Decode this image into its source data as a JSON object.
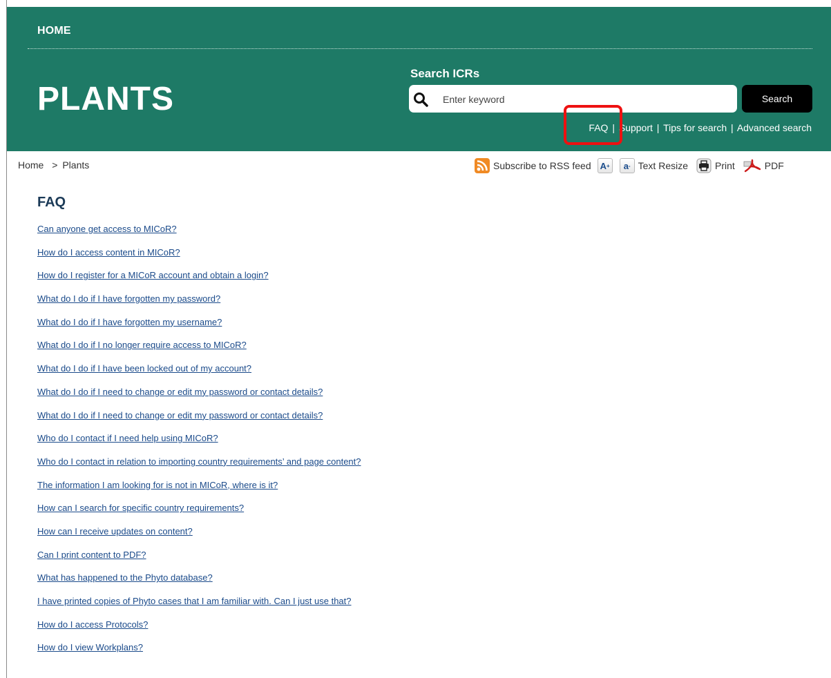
{
  "nav": {
    "home_label": "HOME"
  },
  "header": {
    "site_title": "PLANTS",
    "search_label": "Search ICRs",
    "search_placeholder": "Enter keyword",
    "search_button": "Search",
    "help_links": [
      "FAQ",
      "Support",
      "Tips for search",
      "Advanced search"
    ],
    "help_separator": "|"
  },
  "breadcrumb": {
    "items": [
      "Home",
      "Plants"
    ],
    "separator": ">"
  },
  "toolbar": {
    "rss_label": "Subscribe to RSS feed",
    "increase_font": "A",
    "increase_font_sup": "+",
    "decrease_font": "a",
    "decrease_font_sup": "-",
    "text_resize_label": "Text Resize",
    "print_label": "Print",
    "pdf_label": "PDF"
  },
  "faq": {
    "heading": "FAQ",
    "questions": [
      "Can anyone get access to MICoR?",
      "How do I access content in MICoR?",
      "How do I register for a MICoR account and obtain a login?",
      "What do I do if I have forgotten my password?",
      "What do I do if I have forgotten my username?",
      "What do I do if I no longer require access to MICoR?",
      "What do I do if I have been locked out of my account?",
      "What do I do if I need to change or edit my password or contact details?",
      "What do I do if I need to change or edit my password or contact details?",
      "Who do I contact if I need help using MICoR?",
      "Who do I contact in relation to importing country requirements’ and page content?",
      "The information I am looking for is not in MICoR, where is it?",
      "How can I search for specific country requirements?",
      "How can I receive updates on content?",
      "Can I print content to PDF?",
      "What has happened to the Phyto database?",
      "I have printed copies of Phyto cases that I am familiar with. Can I just use that?",
      "How do I access Protocols?",
      "How do I view Workplans?"
    ]
  },
  "colors": {
    "header_bg": "#1e7a66",
    "link": "#1a4a8a",
    "heading": "#1b3a57",
    "highlight": "#ee1111"
  },
  "icons": {
    "search": "magnifier-icon",
    "rss": "rss-icon",
    "print": "printer-icon",
    "pdf": "pdf-icon"
  }
}
